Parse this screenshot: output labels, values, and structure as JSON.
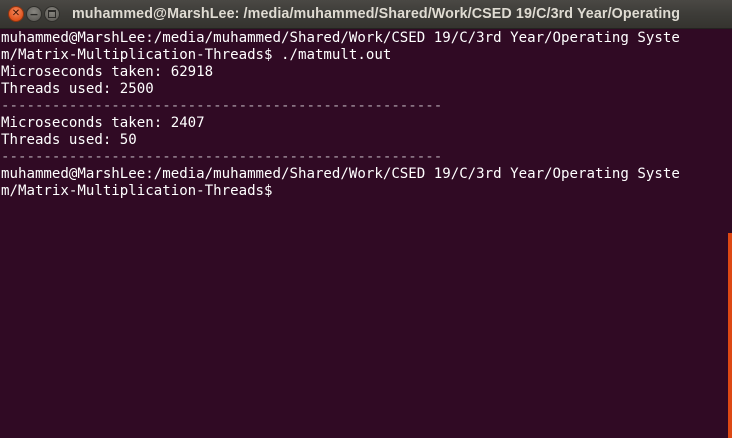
{
  "window": {
    "title": "muhammed@MarshLee: /media/muhammed/Shared/Work/CSED 19/C/3rd Year/Operating",
    "buttons": {
      "close_glyph": "✕",
      "minimize_glyph": "−"
    }
  },
  "terminal": {
    "lines": [
      "muhammed@MarshLee:/media/muhammed/Shared/Work/CSED 19/C/3rd Year/Operating Syste",
      "m/Matrix-Multiplication-Threads$ ./matmult.out",
      "Microseconds taken: 62918",
      "Threads used: 2500",
      "----------------------------------------------------",
      "Microseconds taken: 2407",
      "Threads used: 50",
      "----------------------------------------------------",
      "muhammed@MarshLee:/media/muhammed/Shared/Work/CSED 19/C/3rd Year/Operating Syste",
      "m/Matrix-Multiplication-Threads$"
    ]
  },
  "colors": {
    "background": "#300a24",
    "text": "#ffffff",
    "titlebar": "#3c3b37",
    "close_button": "#e0531d",
    "scrollbar": "#dd4814"
  }
}
